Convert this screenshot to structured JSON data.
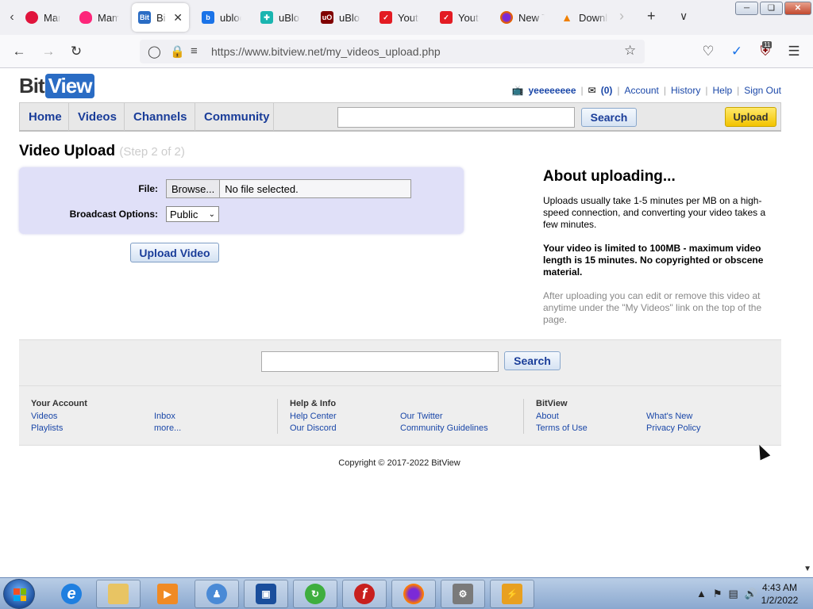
{
  "browser": {
    "tabs": [
      {
        "label": "Mama",
        "favicon": "red-heart-icon",
        "color": "#e0143c"
      },
      {
        "label": "Mama",
        "favicon": "tinder-flame-icon",
        "color": "#fd267a"
      },
      {
        "label": "BitView",
        "favicon": "bitview-icon",
        "color": "#2a6cc4",
        "active": true
      },
      {
        "label": "ublock",
        "favicon": "bing-icon",
        "color": "#1a73e8"
      },
      {
        "label": "uBlock",
        "favicon": "ublock-puzzle-icon",
        "color": "#1ab5b0"
      },
      {
        "label": "uBlock",
        "favicon": "ublock-shield-icon",
        "color": "#800000"
      },
      {
        "label": "Youtube",
        "favicon": "youtube-pocket-icon",
        "color": "#e31b23"
      },
      {
        "label": "Youtube",
        "favicon": "youtube-pocket-icon",
        "color": "#e31b23"
      },
      {
        "label": "New Tab",
        "favicon": "firefox-icon",
        "color": "#e66000"
      },
      {
        "label": "Download",
        "favicon": "vlc-cone-icon",
        "color": "#f08000"
      }
    ],
    "url": "https://www.bitview.net/my_videos_upload.php",
    "ublock_badge": "11"
  },
  "site": {
    "logo_bit": "Bit",
    "logo_view": "View",
    "user": {
      "name": "yeeeeeeee",
      "inbox": "(0)",
      "links": [
        "Account",
        "History",
        "Help",
        "Sign Out"
      ]
    },
    "menu": [
      "Home",
      "Videos",
      "Channels",
      "Community"
    ],
    "search_label": "Search",
    "upload_label": "Upload"
  },
  "upload": {
    "title": "Video Upload",
    "step": "(Step 2 of 2)",
    "file_label": "File:",
    "browse_label": "Browse...",
    "file_status": "No file selected.",
    "broadcast_label": "Broadcast Options:",
    "broadcast_value": "Public",
    "submit_label": "Upload Video"
  },
  "about": {
    "title": "About uploading...",
    "p1": "Uploads usually take 1-5 minutes per MB on a high-speed connection, and converting your video takes a few minutes.",
    "p2": "Your video is limited to 100MB - maximum video length is 15 minutes. No copyrighted or obscene material.",
    "p3": "After uploading you can edit or remove this video at anytime under the \"My Videos\" link on the top of the page."
  },
  "footer": {
    "search_label": "Search",
    "col1_title": "Your Account",
    "col1": [
      "Videos",
      "Playlists",
      "Inbox",
      "more..."
    ],
    "col2_title": "Help & Info",
    "col2": [
      "Help Center",
      "Our Discord",
      "Our Twitter",
      "Community Guidelines"
    ],
    "col3_title": "BitView",
    "col3": [
      "About",
      "Terms of Use",
      "What's New",
      "Privacy Policy"
    ],
    "copyright": "Copyright © 2017-2022 BitView"
  },
  "taskbar": {
    "time": "4:43 AM",
    "date": "1/2/2022"
  }
}
